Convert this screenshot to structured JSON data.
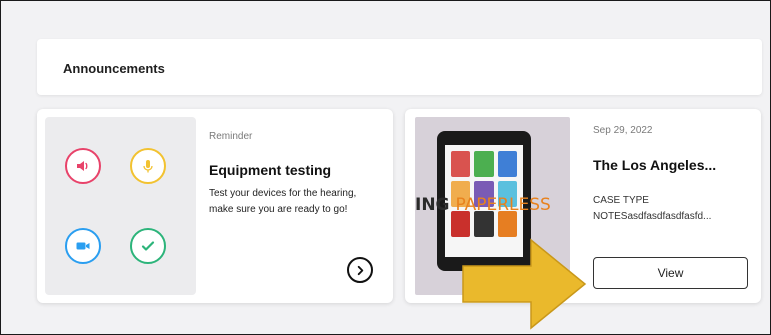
{
  "announcements": {
    "title": "Announcements"
  },
  "cards": [
    {
      "label": "Reminder",
      "title": "Equipment testing",
      "body": "Test your devices for the hearing, make sure you are ready to go!",
      "icons": [
        "speaker-icon",
        "microphone-icon",
        "camera-icon",
        "checkmark-icon"
      ],
      "action_icon": "chevron-right-icon"
    },
    {
      "date": "Sep 29, 2022",
      "title": "The Los Angeles...",
      "case_type_label": "CASE TYPE",
      "notes": "NOTESasdfasdfasdfasfd...",
      "thumbnail_text_dark": "ING ",
      "thumbnail_text_orange": "PAPERLESS",
      "button_label": "View"
    }
  ],
  "colors": {
    "speaker": "#e8436a",
    "microphone": "#f2c230",
    "camera": "#2a9ef0",
    "check": "#2cb47a",
    "annotation_arrow": "#eab92c"
  }
}
